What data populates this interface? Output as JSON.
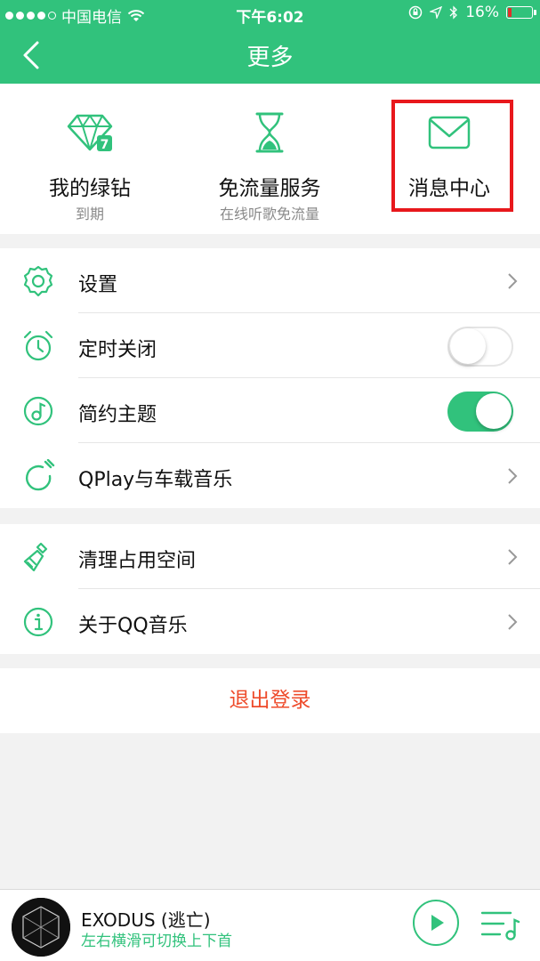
{
  "status_bar": {
    "carrier": "中国电信",
    "time": "下午6:02",
    "battery": "16%"
  },
  "nav": {
    "title": "更多"
  },
  "features": [
    {
      "title": "我的绿钻",
      "subtitle": "到期",
      "icon": "green-diamond-icon",
      "badge": "7"
    },
    {
      "title": "免流量服务",
      "subtitle": "在线听歌免流量",
      "icon": "hourglass-icon"
    },
    {
      "title": "消息中心",
      "subtitle": "",
      "icon": "envelope-icon"
    }
  ],
  "settings_group": [
    {
      "label": "设置",
      "control": "chevron",
      "icon": "gear-icon"
    },
    {
      "label": "定时关闭",
      "control": "toggle",
      "state": "off",
      "icon": "alarm-clock-icon"
    },
    {
      "label": "简约主题",
      "control": "toggle",
      "state": "on",
      "icon": "theme-note-icon"
    },
    {
      "label": "QPlay与车载音乐",
      "control": "chevron",
      "icon": "qplay-icon"
    }
  ],
  "misc_group": [
    {
      "label": "清理占用空间",
      "control": "chevron",
      "icon": "brush-icon"
    },
    {
      "label": "关于QQ音乐",
      "control": "chevron",
      "icon": "info-icon"
    }
  ],
  "logout": {
    "label": "退出登录"
  },
  "player": {
    "song": "EXODUS (逃亡)",
    "hint": "左右横滑可切换上下首"
  },
  "colors": {
    "brand": "#31c27c",
    "logout": "#ee4b2b",
    "highlight": "#e8181c"
  }
}
